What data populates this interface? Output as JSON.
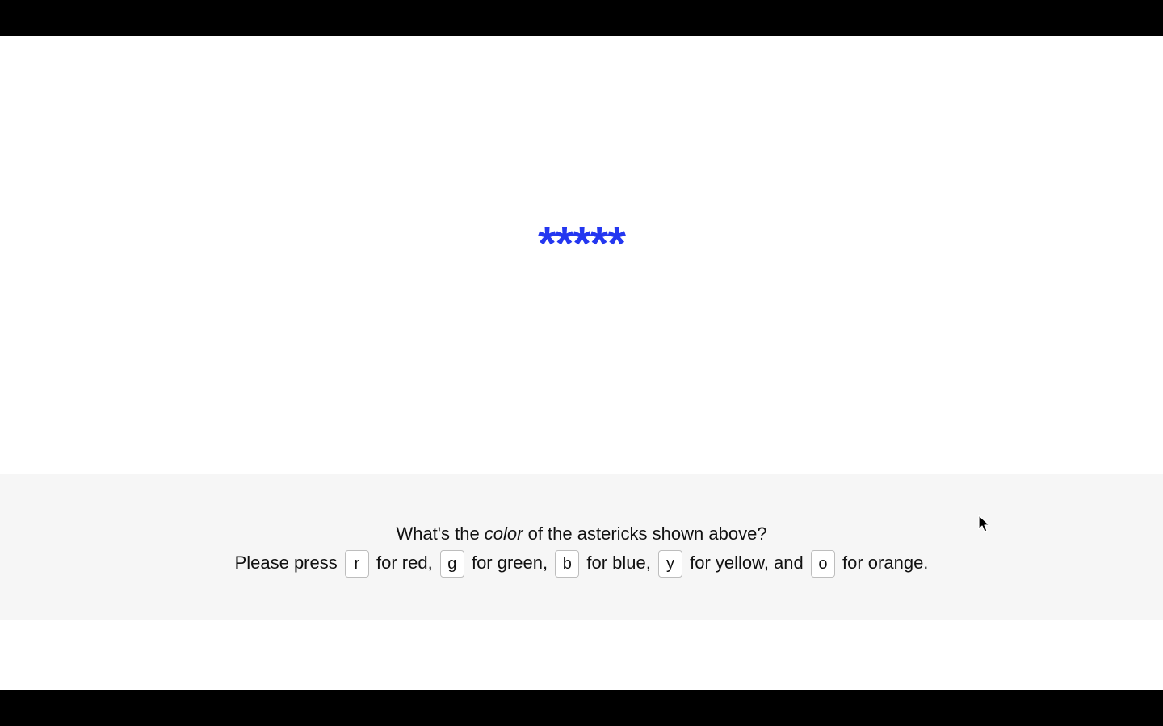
{
  "stimulus": {
    "text": "*****",
    "color": "#2437f0"
  },
  "instructions": {
    "question_prefix": "What's the ",
    "question_emphasis": "color",
    "question_suffix": " of the astericks shown above?",
    "press_prefix": "Please press",
    "keys": [
      {
        "key": "r",
        "label": "for red,"
      },
      {
        "key": "g",
        "label": "for green,"
      },
      {
        "key": "b",
        "label": "for blue,"
      },
      {
        "key": "y",
        "label": "for yellow, and"
      },
      {
        "key": "o",
        "label": "for orange."
      }
    ]
  },
  "icons": {
    "cursor": "mouse-pointer-icon"
  }
}
